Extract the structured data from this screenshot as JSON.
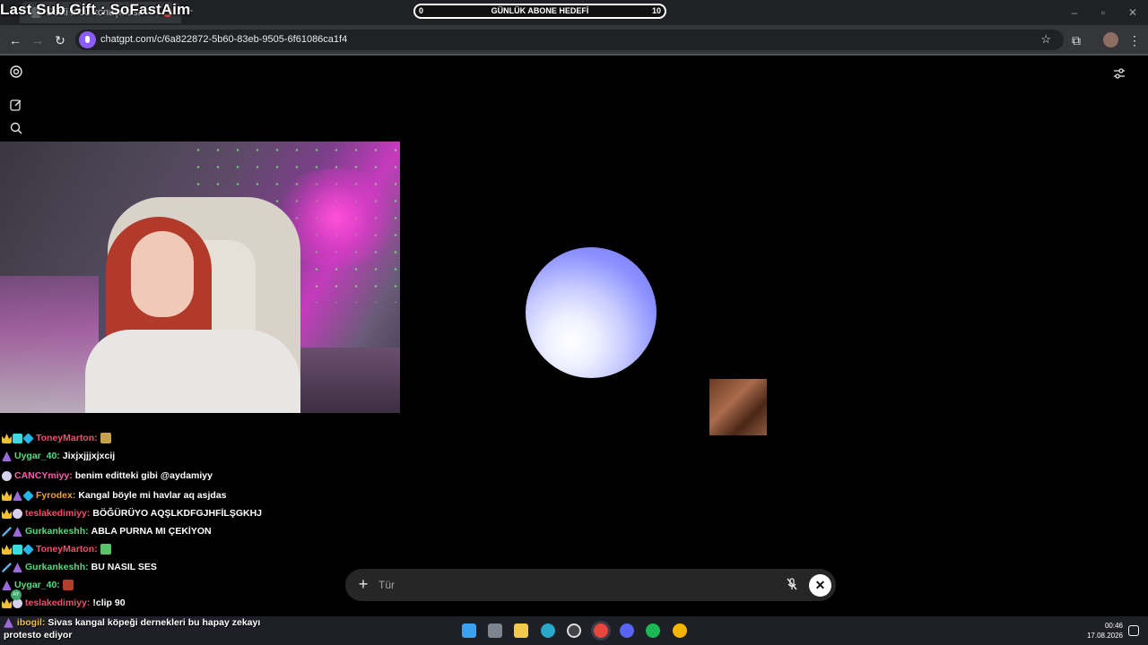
{
  "overlay": {
    "title": "Last Sub Gift : SoFastAim",
    "goal_left": "0",
    "goal_label": "GÜNLÜK ABONE HEDEFİ",
    "goal_right": "10"
  },
  "browser": {
    "tab_title": "Sesli mod konuşması",
    "url": "chatgpt.com/c/6a822872-5b60-83eb-9505-6f61086ca1f4"
  },
  "chat": {
    "messages": [
      {
        "user": "ToneyMarton:",
        "color": "#ff4b6e",
        "text": "",
        "badges": [
          "crown",
          "sub",
          "gem"
        ],
        "emote": "#c7a24a"
      },
      {
        "user": "Uygar_40:",
        "color": "#4ee07c",
        "text": "Jixjxjjjxjxcij",
        "badges": [
          "wiz"
        ]
      },
      {
        "user": "CANCYmiyy:",
        "color": "#ff5bb0",
        "text": "benim editteki gibi @aydamiyy",
        "badges": [
          "moon"
        ]
      },
      {
        "user": "Fyrodex:",
        "color": "#f0a030",
        "text": "Kangal böyle mi havlar aq asjdas",
        "badges": [
          "crown",
          "wiz",
          "gem"
        ]
      },
      {
        "user": "teslakedimiyy:",
        "color": "#ff4b6e",
        "text": "BÖĞÜRÜYO AQŞLKDFGJHFİLŞGKHJ",
        "badges": [
          "crown",
          "moon"
        ]
      },
      {
        "user": "Gurkankeshh:",
        "color": "#4ee07c",
        "text": "ABLA PURNA MI ÇEKİYON",
        "badges": [
          "sword",
          "wiz"
        ]
      },
      {
        "user": "ToneyMarton:",
        "color": "#ff4b6e",
        "text": "",
        "badges": [
          "crown",
          "sub",
          "gem"
        ],
        "emote": "#5bc46a"
      },
      {
        "user": "Gurkankeshh:",
        "color": "#4ee07c",
        "text": "BU NASIL SES",
        "badges": [
          "sword",
          "wiz"
        ]
      },
      {
        "user": "Uygar_40:",
        "color": "#4ee07c",
        "text": "",
        "badges": [
          "wiz"
        ],
        "emote": "#b0402c"
      },
      {
        "user": "teslakedimiyy:",
        "color": "#ff4b6e",
        "text": "!clip 90",
        "badges": [
          "crown",
          "moon"
        ]
      }
    ],
    "bottom": {
      "user": "ibogil:",
      "color": "#f0c040",
      "text": "Sivas kangal köpeği dernekleri bu hapay zekayı protesto ediyor"
    },
    "viewer_initials": "AY"
  },
  "composer": {
    "placeholder": "Tür"
  },
  "taskbar": {
    "time": "00:46",
    "date": "17.08.2026"
  }
}
